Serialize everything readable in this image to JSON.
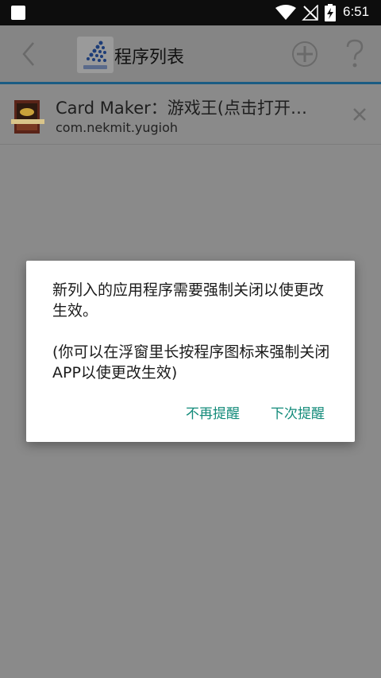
{
  "status_bar": {
    "time": "6:51"
  },
  "app_bar": {
    "title": "程序列表"
  },
  "list": [
    {
      "name": "Card Maker：游戏王(点击打开…",
      "package": "com.nekmit.yugioh"
    }
  ],
  "dialog": {
    "message": "新列入的应用程序需要强制关闭以使更改生效。\n\n(你可以在浮窗里长按程序图标来强制关闭APP以使更改生效)",
    "buttons": {
      "never_remind": "不再提醒",
      "remind_next": "下次提醒"
    }
  },
  "colors": {
    "accent": "#138b7a",
    "app_bar_line": "#1a5c83",
    "scrim": "#8a8a8a"
  }
}
